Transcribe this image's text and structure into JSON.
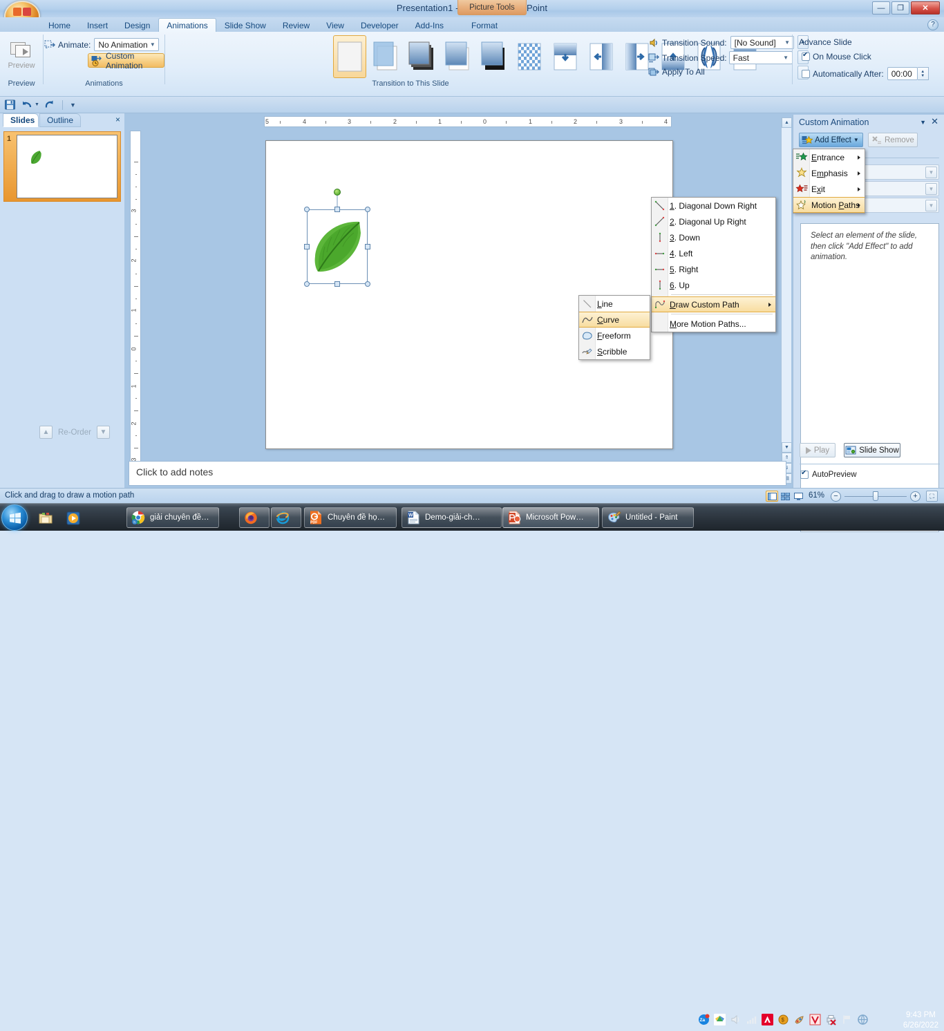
{
  "window": {
    "title": "Presentation1 - Microsoft PowerPoint",
    "contextual_tab_group": "Picture Tools",
    "minimize": "—",
    "restore": "❐",
    "close": "✕",
    "help": "?"
  },
  "tabs": [
    {
      "label": "Home",
      "active": false
    },
    {
      "label": "Insert",
      "active": false
    },
    {
      "label": "Design",
      "active": false
    },
    {
      "label": "Animations",
      "active": true
    },
    {
      "label": "Slide Show",
      "active": false
    },
    {
      "label": "Review",
      "active": false
    },
    {
      "label": "View",
      "active": false
    },
    {
      "label": "Developer",
      "active": false
    },
    {
      "label": "Add-Ins",
      "active": false
    },
    {
      "label": "Format",
      "active": false
    }
  ],
  "ribbon": {
    "groups": [
      {
        "title": "Preview"
      },
      {
        "title": "Animations"
      },
      {
        "title": "Transition to This Slide"
      }
    ],
    "preview_button": "Preview",
    "animate_label": "Animate:",
    "animate_value": "No Animation",
    "custom_animation": "Custom Animation",
    "transition_sound_label": "Transition Sound:",
    "transition_sound_value": "[No Sound]",
    "transition_speed_label": "Transition Speed:",
    "transition_speed_value": "Fast",
    "apply_to_all": "Apply To All",
    "advance_slide_label": "Advance Slide",
    "on_mouse_click": "On Mouse Click",
    "on_mouse_click_checked": true,
    "automatically_after": "Automatically After:",
    "automatically_after_checked": false,
    "automatically_after_value": "00:00",
    "gallery_scroll_up": "▲",
    "gallery_scroll_down": "▼",
    "gallery_scroll_more": "▼"
  },
  "left_pane": {
    "tab_slides": "Slides",
    "tab_outline": "Outline",
    "close": "×",
    "slide_number": "1"
  },
  "rulers": {
    "horizontal": [
      "5",
      "4",
      "3",
      "2",
      "1",
      "0",
      "1",
      "2",
      "3",
      "4"
    ],
    "vertical": [
      "3",
      "2",
      "1",
      "0",
      "1",
      "2",
      "3"
    ]
  },
  "notes": {
    "placeholder": "Click to add notes"
  },
  "task_pane": {
    "title": "Custom Animation",
    "dropdown": "▼",
    "close": "✕",
    "add_effect": "Add Effect",
    "add_effect_caret": "▼",
    "remove": "Remove",
    "hint": "Select an element of the slide, then click \"Add Effect\" to add animation.",
    "reorder": "Re-Order",
    "reorder_up": "▲",
    "reorder_down": "▼",
    "play": "Play",
    "slide_show": "Slide Show",
    "autopreview": "AutoPreview",
    "autopreview_checked": true
  },
  "menus": {
    "add_effect": {
      "items": [
        {
          "label": "Entrance",
          "underline": "E",
          "submenu": true,
          "highlighted": false,
          "icon": "green-star-icon"
        },
        {
          "label": "Emphasis",
          "underline": "m",
          "submenu": true,
          "highlighted": false,
          "icon": "yellow-star-icon"
        },
        {
          "label": "Exit",
          "underline": "x",
          "submenu": true,
          "highlighted": false,
          "icon": "red-star-icon"
        },
        {
          "label": "Motion Paths",
          "underline": "P",
          "submenu": true,
          "highlighted": true,
          "icon": "outline-star-icon"
        }
      ]
    },
    "motion_paths": {
      "items": [
        {
          "label": "1. Diagonal Down Right",
          "underline": "1",
          "submenu": false,
          "highlighted": false,
          "icon": "diagonal-down-right-icon"
        },
        {
          "label": "2. Diagonal Up Right",
          "underline": "2",
          "submenu": false,
          "highlighted": false,
          "icon": "diagonal-up-right-icon"
        },
        {
          "label": "3. Down",
          "underline": "3",
          "submenu": false,
          "highlighted": false,
          "icon": "down-icon"
        },
        {
          "label": "4. Left",
          "underline": "4",
          "submenu": false,
          "highlighted": false,
          "icon": "left-icon"
        },
        {
          "label": "5. Right",
          "underline": "5",
          "submenu": false,
          "highlighted": false,
          "icon": "right-icon"
        },
        {
          "label": "6. Up",
          "underline": "6",
          "submenu": false,
          "highlighted": false,
          "icon": "up-icon"
        },
        {
          "separator": true
        },
        {
          "label": "Draw Custom Path",
          "underline": "D",
          "submenu": true,
          "highlighted": true,
          "icon": "draw-custom-path-icon"
        },
        {
          "separator": true
        },
        {
          "label": "More Motion Paths...",
          "underline": "M",
          "submenu": false,
          "highlighted": false,
          "icon": ""
        }
      ]
    },
    "draw_custom_path": {
      "items": [
        {
          "label": "Line",
          "underline": "L",
          "highlighted": false,
          "icon": "line-icon"
        },
        {
          "label": "Curve",
          "underline": "C",
          "highlighted": true,
          "icon": "curve-icon"
        },
        {
          "label": "Freeform",
          "underline": "F",
          "highlighted": false,
          "icon": "freeform-icon"
        },
        {
          "label": "Scribble",
          "underline": "S",
          "highlighted": false,
          "icon": "scribble-icon"
        }
      ]
    }
  },
  "status_bar": {
    "message": "Click and drag to draw a motion path",
    "zoom_level": "61%",
    "zoom_out": "−",
    "zoom_in": "+",
    "view_normal": "normal-view-icon",
    "view_sorter": "slide-sorter-icon",
    "view_show": "slide-show-icon",
    "fit_to_window": "fit-slide-icon"
  },
  "taskbar": {
    "start": "start-orb",
    "quick_launch": [
      "explorer-icon",
      "media-player-icon"
    ],
    "buttons": [
      {
        "label": "giải chuyên đề…",
        "icon": "chrome-icon",
        "active": false
      },
      {
        "label": "",
        "icon": "firefox-icon",
        "active": false
      },
      {
        "label": "",
        "icon": "internet-explorer-icon",
        "active": false
      },
      {
        "label": "Chuyên đề họ…",
        "icon": "pdf-icon",
        "active": false
      },
      {
        "label": "Demo-giải-ch…",
        "icon": "word-icon",
        "active": false
      },
      {
        "label": "Microsoft Pow…",
        "icon": "powerpoint-icon",
        "active": true
      },
      {
        "label": "Untitled - Paint",
        "icon": "paint-icon",
        "active": false
      }
    ],
    "tray_icons": [
      "zalo-icon",
      "google-drive-icon",
      "volume-icon",
      "network-icon",
      "avira-icon",
      "coin-icon",
      "unikey-icon",
      "v-icon",
      "printer-error-icon",
      "flag-icon",
      "browser-icon"
    ],
    "clock_time": "9:43 PM",
    "clock_date": "6/26/2022"
  },
  "colors": {
    "accent": "#15497e",
    "highlight": "#f8dda0",
    "highlight_border": "#e0a93f",
    "ribbon_bg": "#e2eefa",
    "pane_bg": "#cfe0f3",
    "workspace_bg": "#a8c6e4",
    "leaf_green": "#4ca832"
  }
}
